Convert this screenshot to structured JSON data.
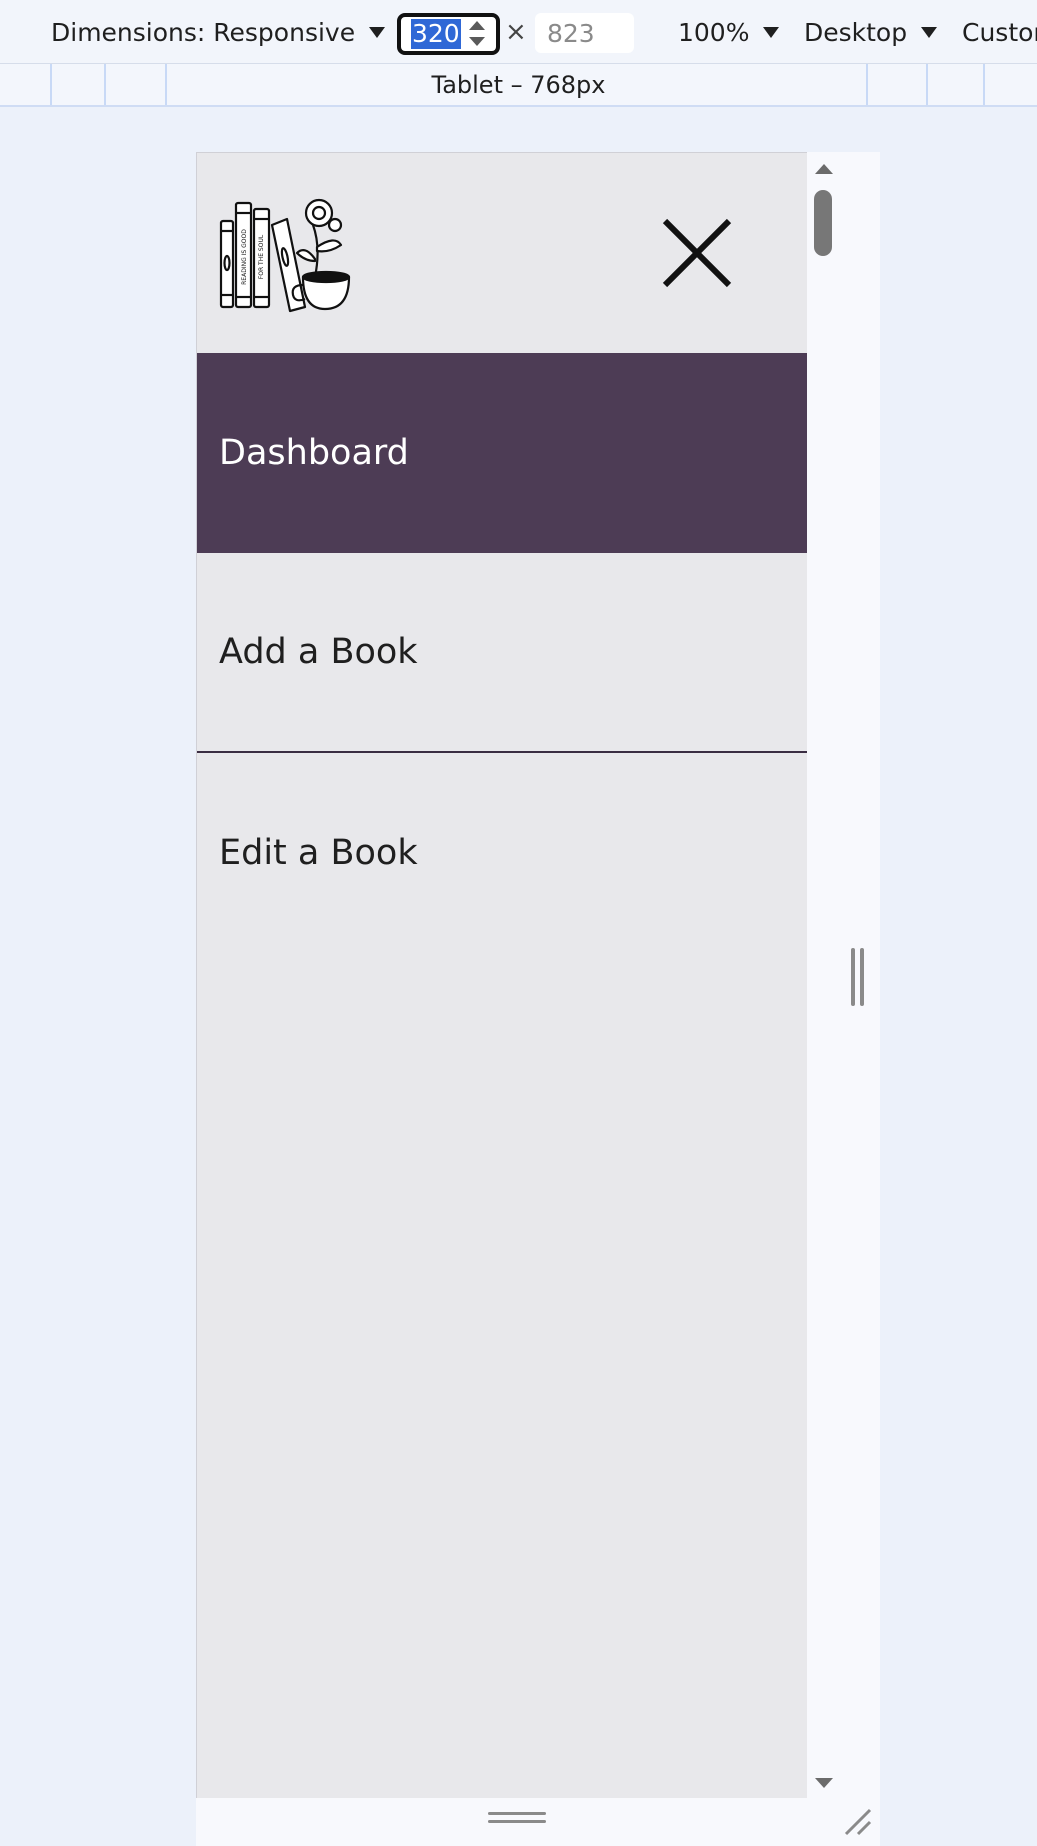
{
  "toolbar": {
    "dimensions_label": "Dimensions: Responsive",
    "width_value": "320",
    "times": "×",
    "height_placeholder": "823",
    "zoom_label": "100%",
    "device_type_label": "Desktop",
    "custom_label": "Custor"
  },
  "breakpoint": {
    "label": "Tablet – 768px"
  },
  "page": {
    "nav": [
      {
        "label": "Dashboard",
        "active": true
      },
      {
        "label": "Add a Book",
        "active": false
      },
      {
        "label": "Edit a Book",
        "active": false
      }
    ],
    "logo_text_1": "READING IS GOOD",
    "logo_text_2": "FOR THE SOUL"
  },
  "colors": {
    "active_nav_bg": "#4d3c55",
    "page_bg": "#e8e8eb",
    "devtools_bg": "#ecf1fa",
    "selection": "#2f68d6"
  },
  "icons": [
    "chevron-down-icon",
    "spin-up-icon",
    "spin-down-icon",
    "close-icon",
    "books-coffee-logo",
    "resize-handle-icon"
  ]
}
